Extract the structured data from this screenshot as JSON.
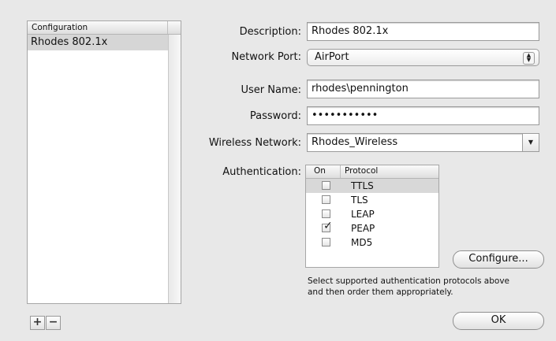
{
  "config_list": {
    "header": "Configuration",
    "items": [
      "Rhodes 802.1x"
    ],
    "add_label": "+",
    "remove_label": "−"
  },
  "form": {
    "description_label": "Description:",
    "description_value": "Rhodes 802.1x",
    "network_port_label": "Network Port:",
    "network_port_value": "AirPort",
    "user_name_label": "User Name:",
    "user_name_value": "rhodes\\pennington",
    "password_label": "Password:",
    "password_value": "•••••••••••",
    "wireless_network_label": "Wireless Network:",
    "wireless_network_value": "Rhodes_Wireless",
    "authentication_label": "Authentication:"
  },
  "auth_table": {
    "col_on": "On",
    "col_protocol": "Protocol",
    "rows": [
      {
        "protocol": "TTLS",
        "checked": false,
        "selected": true
      },
      {
        "protocol": "TLS",
        "checked": false,
        "selected": false
      },
      {
        "protocol": "LEAP",
        "checked": false,
        "selected": false
      },
      {
        "protocol": "PEAP",
        "checked": true,
        "selected": false
      },
      {
        "protocol": "MD5",
        "checked": false,
        "selected": false
      }
    ]
  },
  "configure_label": "Configure...",
  "help_text_line1": "Select supported authentication protocols above",
  "help_text_line2": "and then order them appropriately.",
  "ok_label": "OK",
  "check_glyph": "✓"
}
